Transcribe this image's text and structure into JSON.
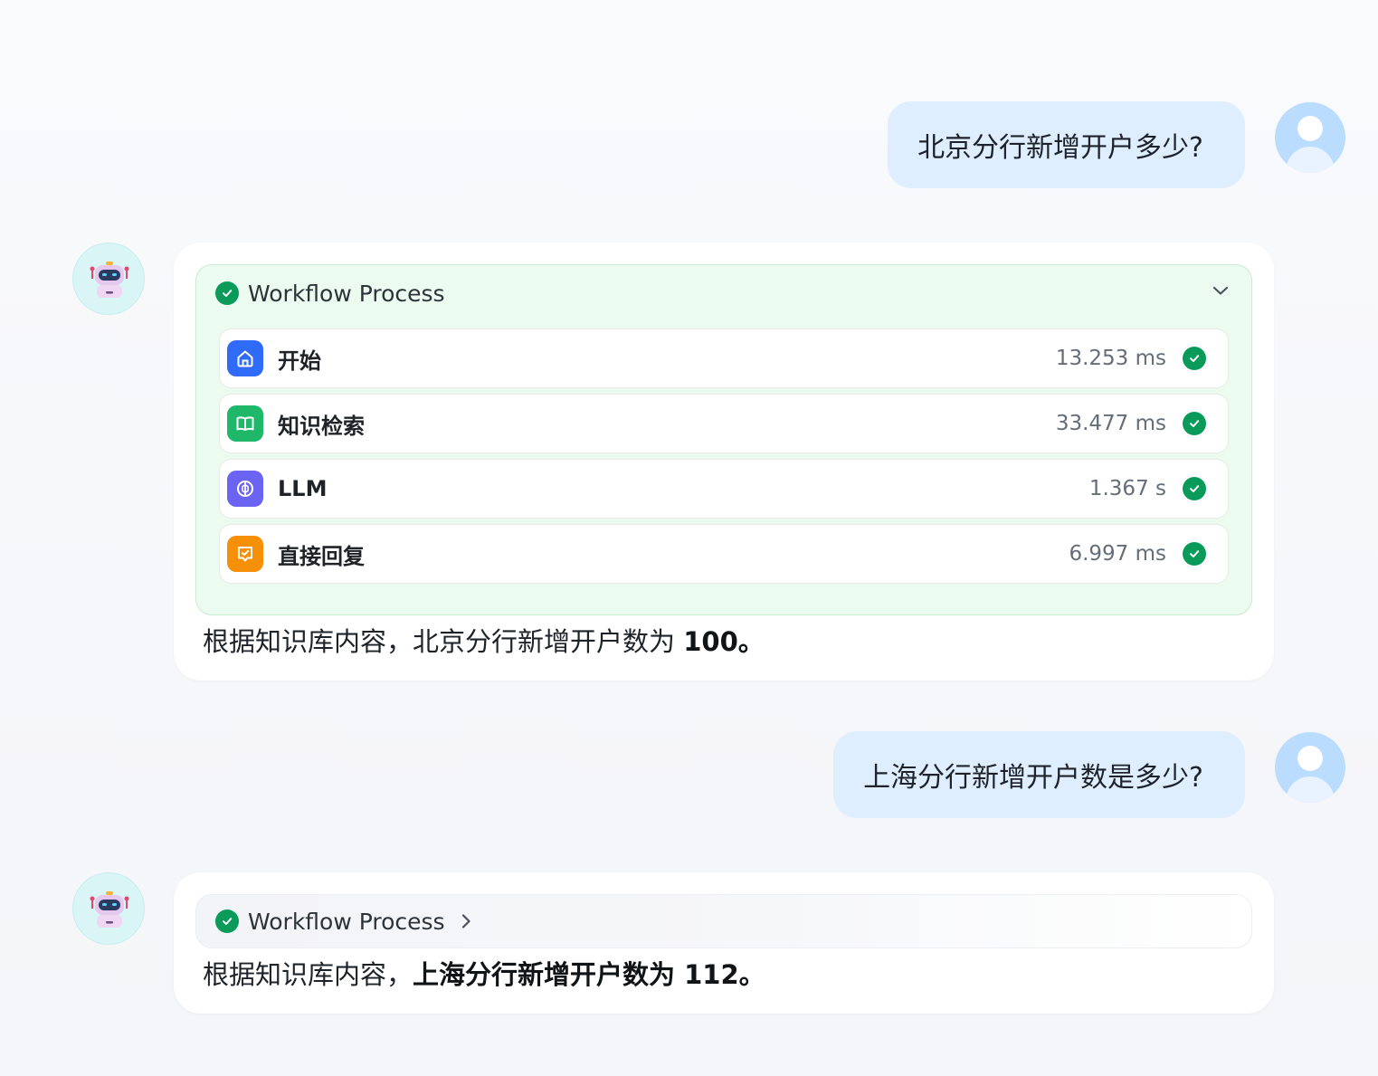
{
  "conversation": {
    "messages": [
      {
        "role": "user",
        "text": "北京分行新增开户多少?"
      },
      {
        "role": "assistant",
        "workflow": {
          "title": "Workflow Process",
          "expanded": true,
          "steps": [
            {
              "name": "开始",
              "time": "13.253 ms",
              "icon": "home-icon",
              "color": "#2f6bf6"
            },
            {
              "name": "知识检索",
              "time": "33.477 ms",
              "icon": "book-icon",
              "color": "#1fb86a"
            },
            {
              "name": "LLM",
              "time": "1.367 s",
              "icon": "llm-brain-icon",
              "color": "#6b63f2"
            },
            {
              "name": "直接回复",
              "time": "6.997 ms",
              "icon": "reply-icon",
              "color": "#f59008"
            }
          ]
        },
        "answer": {
          "plain": "根据知识库内容，北京分行新增开户数为 ",
          "bold": "100。"
        }
      },
      {
        "role": "user",
        "text": "上海分行新增开户数是多少?"
      },
      {
        "role": "assistant",
        "workflow": {
          "title": "Workflow Process",
          "expanded": false
        },
        "answer": {
          "plain": "根据知识库内容，",
          "bold": "上海分行新增开户数为 112。"
        }
      }
    ]
  },
  "colors": {
    "success": "#0a9b5a",
    "user_bubble": "#dfeeff",
    "workflow_bg": "#ecfbef"
  }
}
